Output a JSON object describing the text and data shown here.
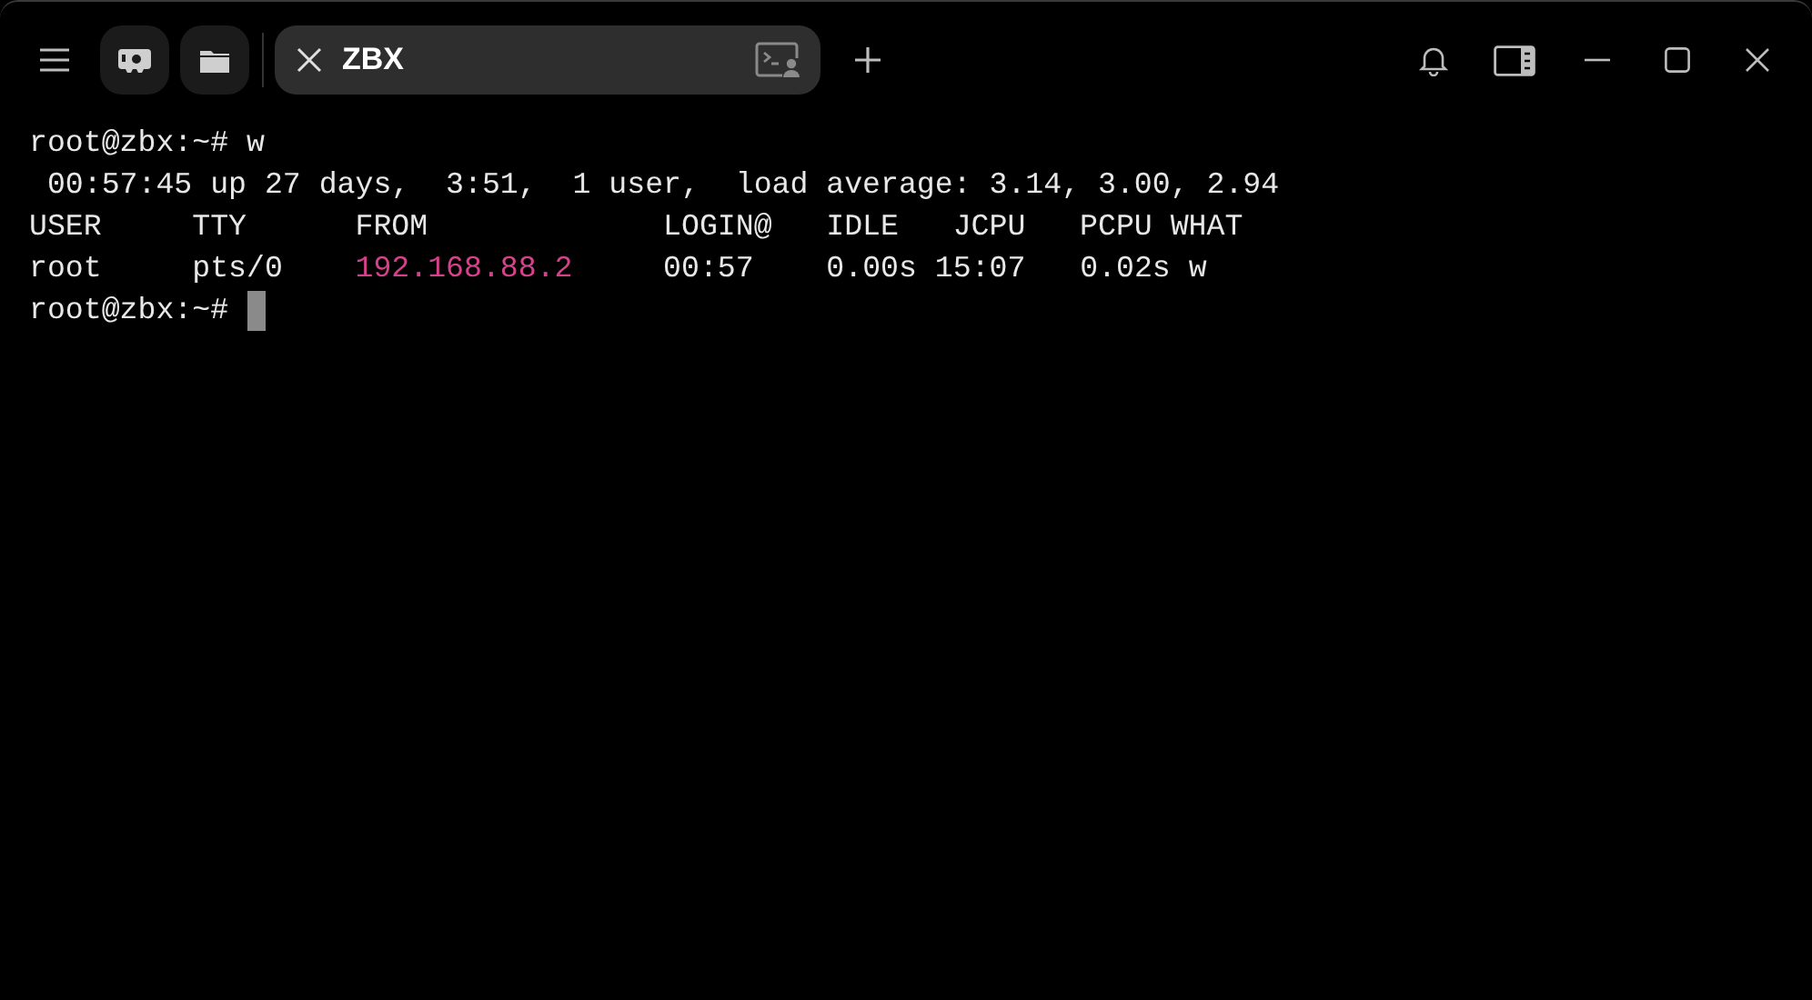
{
  "tabs": [
    {
      "title": "ZBX",
      "selected": true
    }
  ],
  "terminal": {
    "lines": [
      [
        {
          "text": "root@zbx:~# w"
        }
      ],
      [
        {
          "text": " 00:57:45 up 27 days,  3:51,  1 user,  load average: 3.14, 3.00, 2.94"
        }
      ],
      [
        {
          "text": "USER     TTY      FROM             LOGIN@   IDLE   JCPU   PCPU WHAT"
        }
      ],
      [
        {
          "text": "root     pts/0    "
        },
        {
          "text": "192.168.88.2",
          "color": "#d6428a"
        },
        {
          "text": "     00:57    0.00s 15:07   0.02s w"
        }
      ],
      [
        {
          "text": "root@zbx:~# "
        }
      ]
    ]
  }
}
